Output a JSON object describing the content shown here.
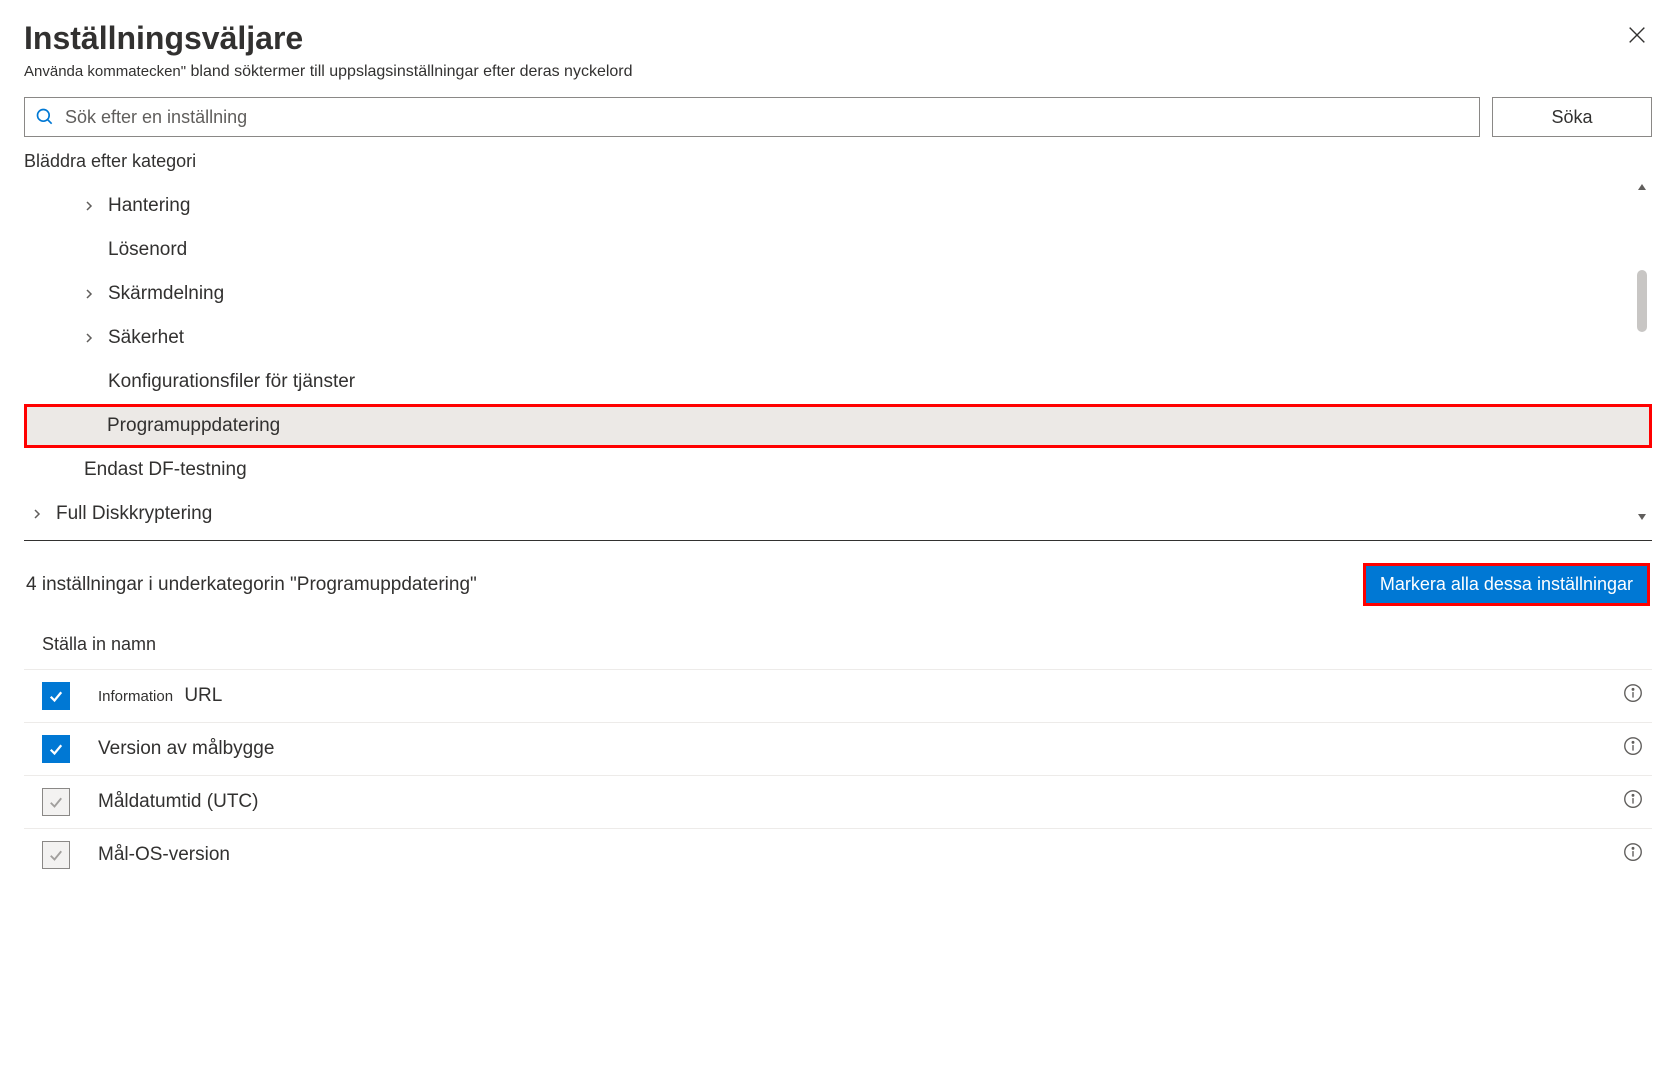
{
  "header": {
    "title": "Inställningsväljare",
    "subtitle_pre": "Använda kommatecken\"",
    "subtitle_rest": "bland söktermer till uppslagsinställningar efter deras nyckelord"
  },
  "search": {
    "placeholder": "Sök efter en inställning",
    "button": "Söka"
  },
  "browse_label": "Bläddra efter kategori",
  "tree": {
    "items": [
      {
        "label": "Hantering",
        "chevron": true,
        "indent": 1
      },
      {
        "label": "Lösenord",
        "chevron": false,
        "indent": 1
      },
      {
        "label": "Skärmdelning",
        "chevron": true,
        "indent": 1
      },
      {
        "label": "Säkerhet",
        "chevron": true,
        "indent": 1
      },
      {
        "label": "Konfigurationsfiler för tjänster",
        "chevron": false,
        "indent": 1
      },
      {
        "label": "Programuppdatering",
        "chevron": false,
        "indent": 1,
        "selected": true
      },
      {
        "label": "Endast DF-testning",
        "chevron": false,
        "indent": 0
      },
      {
        "label": "Full Diskkryptering",
        "chevron": true,
        "indent": 0
      }
    ]
  },
  "results": {
    "summary": "4 inställningar i underkategorin \"Programuppdatering\"",
    "select_all": "Markera alla dessa inställningar",
    "col_header": "Ställa in namn",
    "rows": [
      {
        "label": "URL",
        "badge": "Information",
        "state": "checked"
      },
      {
        "label": "Version av målbygge",
        "state": "checked"
      },
      {
        "label": "Måldatumtid (UTC)",
        "state": "grey"
      },
      {
        "label": "Mål-OS-version",
        "state": "grey"
      }
    ]
  }
}
